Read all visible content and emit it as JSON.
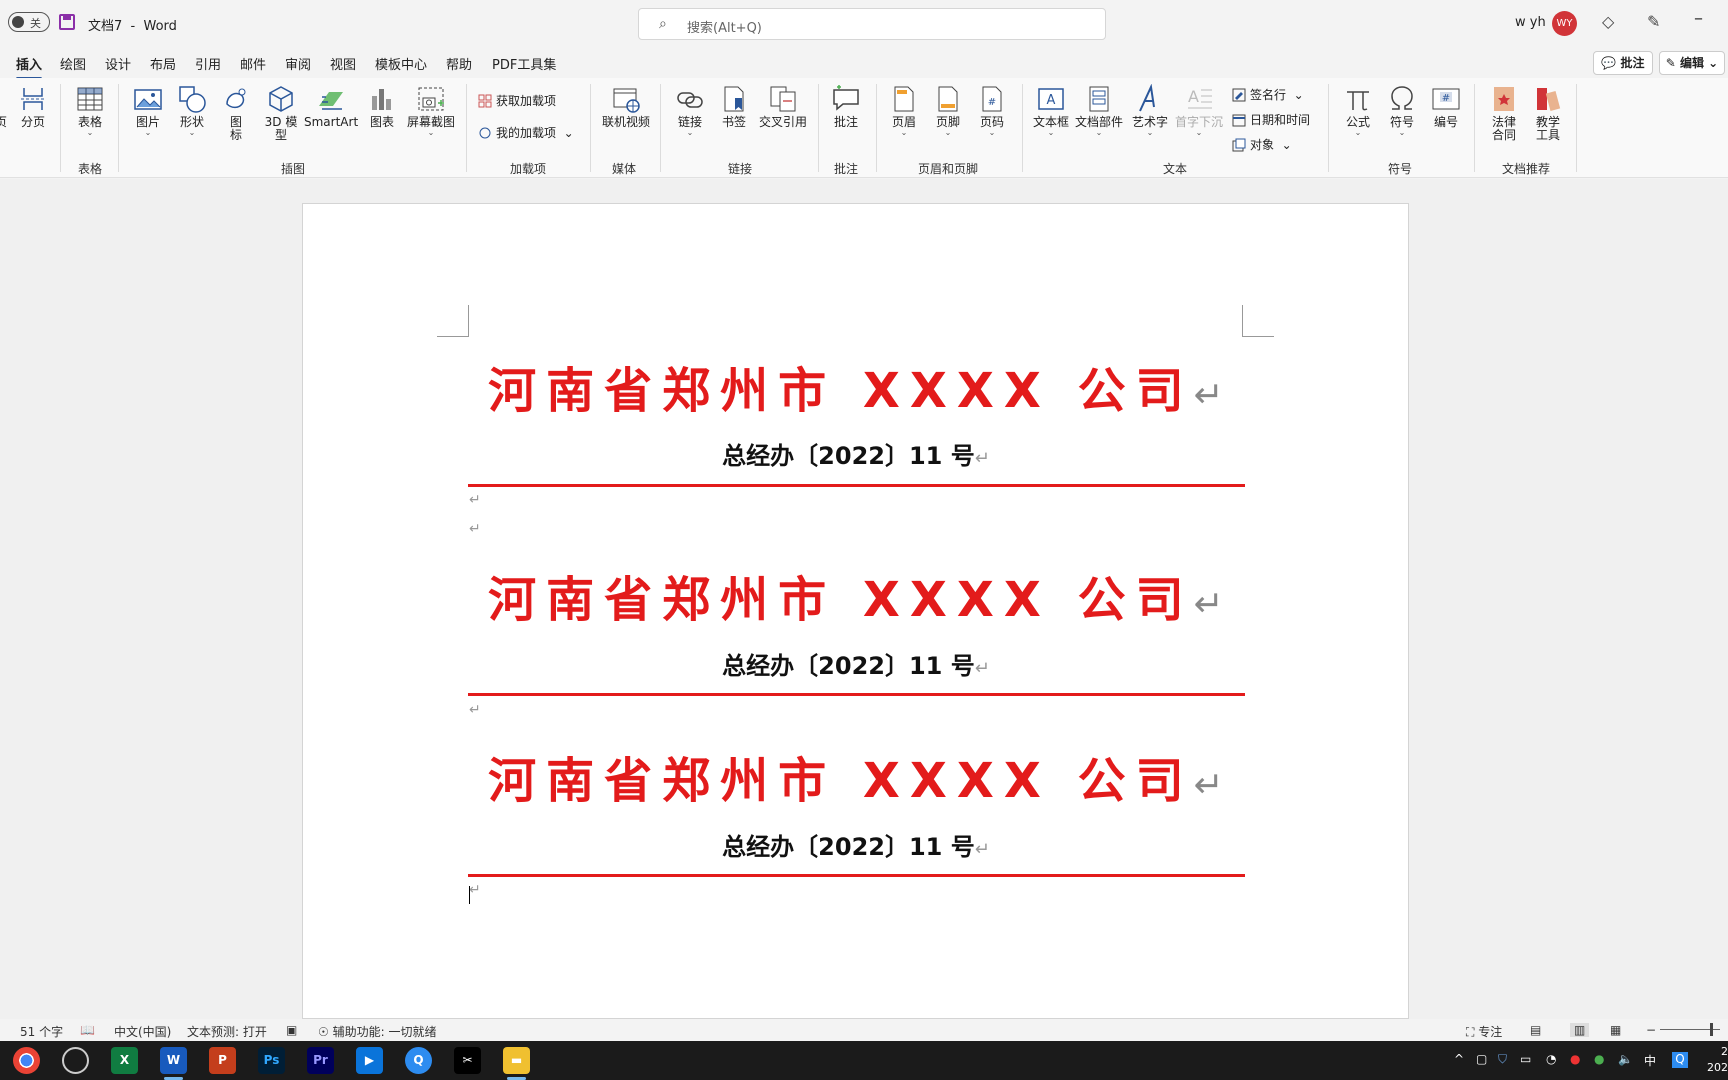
{
  "titlebar": {
    "autosave_label": "关",
    "doc_name": "文档7",
    "separator": "-",
    "app_name": "Word",
    "search_placeholder": "搜索(Alt+Q)",
    "user_name": "w yh",
    "avatar_initials": "WY"
  },
  "tabs": [
    "插入",
    "绘图",
    "设计",
    "布局",
    "引用",
    "邮件",
    "审阅",
    "视图",
    "模板中心",
    "帮助",
    "PDF工具集"
  ],
  "active_tab": "插入",
  "actions": {
    "comment": "批注",
    "edit": "编辑"
  },
  "ribbon": {
    "page": {
      "label1": "页",
      "label2": "分页"
    },
    "table": {
      "label": "表格",
      "group": "表格"
    },
    "illustrations": {
      "picture": "图片",
      "shapes": "形状",
      "icons_1": "图",
      "icons_2": "标",
      "model_1": "3D 模",
      "model_2": "型",
      "smartart": "SmartArt",
      "chart": "图表",
      "screenshot": "屏幕截图",
      "group": "插图"
    },
    "addins": {
      "get": "获取加载项",
      "mine": "我的加载项",
      "group": "加载项"
    },
    "media": {
      "video": "联机视频",
      "group": "媒体"
    },
    "links": {
      "link": "链接",
      "bookmark": "书签",
      "crossref": "交叉引用",
      "group": "链接"
    },
    "comments": {
      "comment": "批注",
      "group": "批注"
    },
    "headerfooter": {
      "header": "页眉",
      "footer": "页脚",
      "pagenum": "页码",
      "group": "页眉和页脚"
    },
    "text": {
      "textbox": "文本框",
      "quickparts": "文档部件",
      "wordart": "艺术字",
      "dropcap": "首字下沉",
      "signature": "签名行",
      "datetime": "日期和时间",
      "object": "对象",
      "group": "文本"
    },
    "symbols": {
      "equation": "公式",
      "symbol": "符号",
      "number": "编号",
      "group": "符号"
    },
    "recommend": {
      "legal_1": "法律",
      "legal_2": "合同",
      "teach_1": "教学",
      "teach_2": "工具",
      "group": "文档推荐"
    }
  },
  "document": {
    "blocks": [
      {
        "title": "河南省郑州市 XXXX 公司",
        "number": "总经办〔2022〕11 号"
      },
      {
        "title": "河南省郑州市 XXXX 公司",
        "number": "总经办〔2022〕11 号"
      },
      {
        "title": "河南省郑州市 XXXX 公司",
        "number": "总经办〔2022〕11 号"
      }
    ],
    "para_mark": "↵"
  },
  "status": {
    "words": "51 个字",
    "language": "中文(中国)",
    "prediction": "文本预测: 打开",
    "accessibility": "辅助功能: 一切就绪",
    "focus": "专注"
  },
  "taskbar": {
    "apps": [
      "chrome",
      "obs",
      "excel",
      "word",
      "powerpoint",
      "photoshop",
      "premiere",
      "video",
      "browser",
      "capcut",
      "explorer"
    ],
    "input_method": "中",
    "clock_line1": "2",
    "clock_line2": "202"
  },
  "colors": {
    "accent": "#2b579a",
    "red_header": "#e31b1b",
    "avatar": "#d13438"
  }
}
